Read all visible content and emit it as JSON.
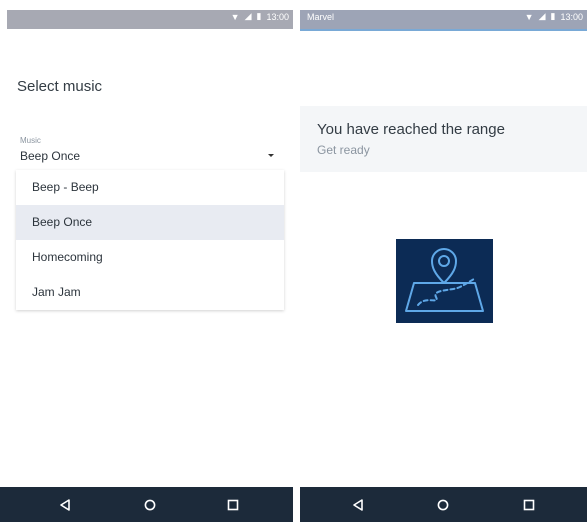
{
  "left_screen": {
    "status": {
      "time": "13:00"
    },
    "page_title": "Select music",
    "music_field": {
      "label": "Music",
      "value": "Beep Once"
    },
    "options": [
      {
        "label": "Beep - Beep",
        "selected": false
      },
      {
        "label": "Beep Once",
        "selected": true
      },
      {
        "label": "Homecoming",
        "selected": false
      },
      {
        "label": "Jam Jam",
        "selected": false
      }
    ]
  },
  "right_screen": {
    "status": {
      "app_name": "Marvel",
      "time": "13:00"
    },
    "headline": "You have reached the range",
    "subtitle": "Get ready",
    "hero_icon": "map-pin-route-icon"
  },
  "nav": {
    "icons": [
      "back-icon",
      "home-icon",
      "recents-icon"
    ]
  },
  "colors": {
    "status_bar": "#a7a9b3",
    "accent_line": "#79a9d6",
    "nav_bar": "#1c2a3a",
    "hero_bg": "#0c2b55",
    "hero_line": "#5fa8e8",
    "selected_row": "#e8ebf2"
  }
}
